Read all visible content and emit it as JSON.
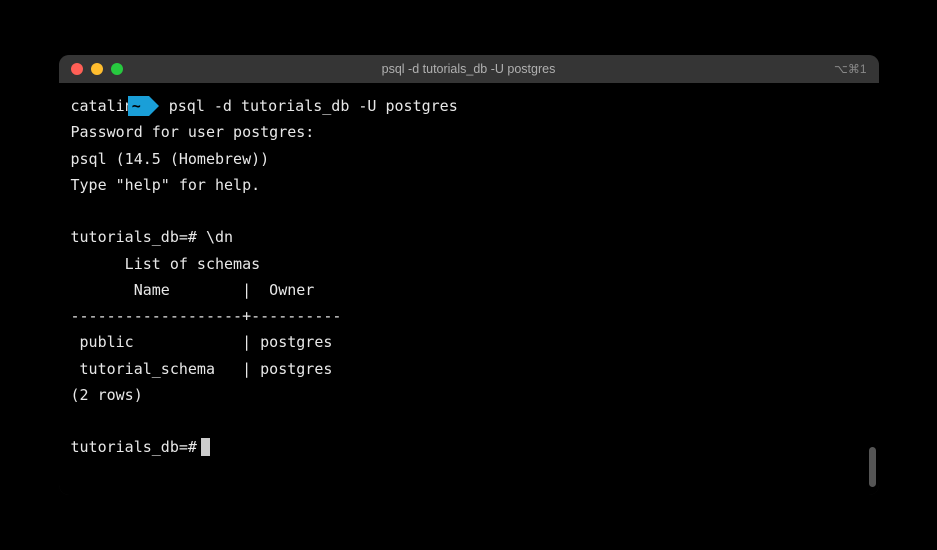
{
  "window": {
    "title": "psql -d tutorials_db -U postgres",
    "shortcut": "⌥⌘1"
  },
  "prompt": {
    "user": "catalin",
    "badge": "~",
    "command": "psql -d tutorials_db -U postgres"
  },
  "output": {
    "password_prompt": "Password for user postgres:",
    "version": "psql (14.5 (Homebrew))",
    "help_hint": "Type \"help\" for help."
  },
  "psql": {
    "prompt1": "tutorials_db=#",
    "command1": "\\dn",
    "list_title": "      List of schemas",
    "header": "       Name        |  Owner",
    "separator": "-------------------+----------",
    "row1": " public            | postgres",
    "row2": " tutorial_schema   | postgres",
    "rowcount": "(2 rows)",
    "prompt2": "tutorials_db=#"
  }
}
